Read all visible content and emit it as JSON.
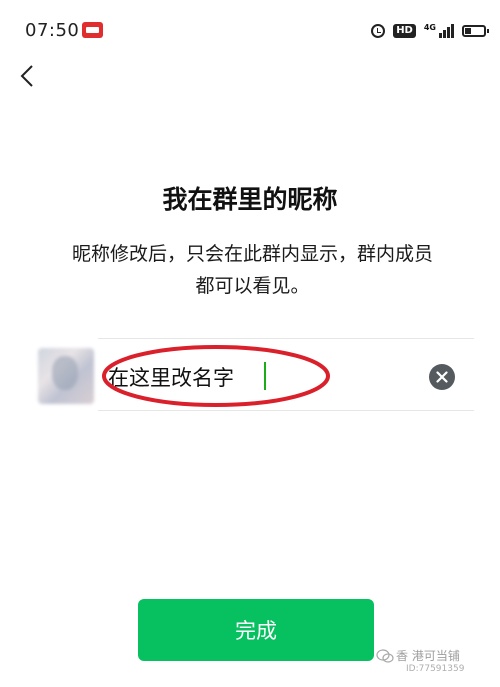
{
  "status_bar": {
    "time": "07:50",
    "hd_label": "HD",
    "network_label": "4G"
  },
  "header": {
    "back_icon": "chevron-left-icon"
  },
  "page": {
    "title": "我在群里的昵称",
    "description_line1": "昵称修改后，只会在此群内显示，群内成员",
    "description_line2": "都可以看见。"
  },
  "nickname": {
    "value": "在这里改名字",
    "clear_icon": "close-circle-icon"
  },
  "annotation": {
    "color": "#d9202b"
  },
  "footer": {
    "done_label": "完成"
  },
  "watermark": {
    "text": "香 港可当铺",
    "id": "ID:77591359"
  },
  "colors": {
    "primary_green": "#07c160",
    "cursor_green": "#1aad19"
  }
}
